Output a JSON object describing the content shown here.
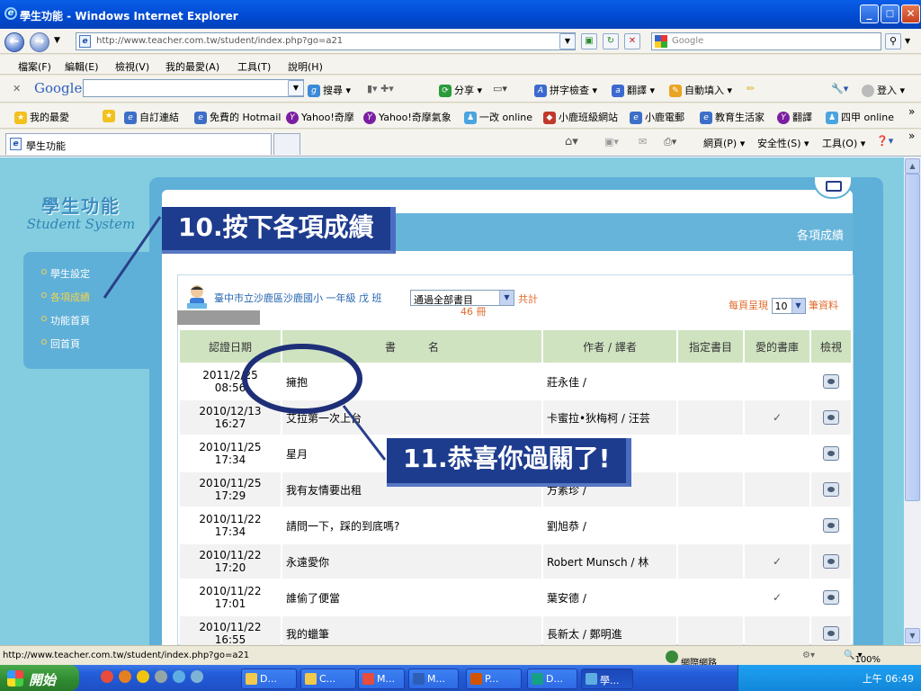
{
  "window": {
    "title": "學生功能 - Windows Internet Explorer",
    "min": "_",
    "max": "□",
    "close": "✕"
  },
  "address": {
    "url": "http://www.teacher.com.tw/student/index.php?go=a21",
    "search_placeholder": "Google"
  },
  "menu": [
    "檔案(F)",
    "編輯(E)",
    "檢視(V)",
    "我的最愛(A)",
    "工具(T)",
    "說明(H)"
  ],
  "google_bar": {
    "logo": "Google",
    "items": [
      "搜尋 ▾",
      "分享 ▾",
      "拼字檢查 ▾",
      "翻譯 ▾",
      "自動填入 ▾"
    ],
    "login": "登入 ▾"
  },
  "favorites": {
    "label": "我的最愛",
    "items": [
      "自訂連結",
      "免費的 Hotmail",
      "Yahoo!奇摩",
      "Yahoo!奇摩氣象",
      "一改 online",
      "小鹿班級網站",
      "小鹿電郵",
      "教育生活家",
      "翻譯",
      "四甲 online"
    ]
  },
  "tab": {
    "label": "學生功能",
    "cmd": [
      "網頁(P) ▾",
      "安全性(S) ▾",
      "工具(O) ▾"
    ]
  },
  "side": {
    "brand_cn": "學生功能",
    "brand_en": "Student System",
    "items": [
      "學生設定",
      "各項成績",
      "功能首頁",
      "回首頁"
    ]
  },
  "header": {
    "section": "各項成績"
  },
  "callouts": {
    "step10": "10.按下各項成績",
    "step11": "11.恭喜你過關了!"
  },
  "info": {
    "school": "臺中市立沙鹿區沙鹿國小 一年級 戊 班",
    "filter": "通過全部書目",
    "total_label": "共計",
    "count": "46 冊",
    "perpage_label": "每頁呈現",
    "perpage_value": "10",
    "perpage_suffix": "筆資料"
  },
  "table": {
    "headers": [
      "認證日期",
      "書　　　名",
      "作者 / 譯者",
      "指定書目",
      "愛的書庫",
      "檢視"
    ],
    "rows": [
      {
        "date": "2011/2/25",
        "time": "08:56",
        "title": "擁抱",
        "author": "莊永佳 /",
        "assigned": "",
        "fav": ""
      },
      {
        "date": "2010/12/13",
        "time": "16:27",
        "title": "艾拉第一次上台",
        "author": "卡蜜拉•狄梅柯 / 汪芸",
        "assigned": "",
        "fav": "✓"
      },
      {
        "date": "2010/11/25",
        "time": "17:34",
        "title": "星月",
        "author": "",
        "assigned": "",
        "fav": ""
      },
      {
        "date": "2010/11/25",
        "time": "17:29",
        "title": "我有友情要出租",
        "author": "方素珍 /",
        "assigned": "",
        "fav": ""
      },
      {
        "date": "2010/11/22",
        "time": "17:34",
        "title": "請問一下，踩的到底嗎?",
        "author": "劉旭恭 /",
        "assigned": "",
        "fav": ""
      },
      {
        "date": "2010/11/22",
        "time": "17:20",
        "title": "永遠愛你",
        "author": "Robert Munsch / 林",
        "assigned": "",
        "fav": "✓"
      },
      {
        "date": "2010/11/22",
        "time": "17:01",
        "title": "誰偷了便當",
        "author": "葉安德 /",
        "assigned": "",
        "fav": "✓"
      },
      {
        "date": "2010/11/22",
        "time": "16:55",
        "title": "我的蠟筆",
        "author": "長新太 / 鄭明進",
        "assigned": "",
        "fav": ""
      }
    ]
  },
  "status": {
    "url": "http://www.teacher.com.tw/student/index.php?go=a21",
    "zone": "網際網路",
    "zoom": "100%"
  },
  "taskbar": {
    "start": "開始",
    "buttons": [
      "D...",
      "C...",
      "M...",
      "M...",
      "P...",
      "D...",
      "學..."
    ],
    "clock": "上午 06:49"
  },
  "colors": {
    "accent": "#1e3c8e",
    "panel": "#5fb0d8",
    "bg": "#84cde0"
  }
}
